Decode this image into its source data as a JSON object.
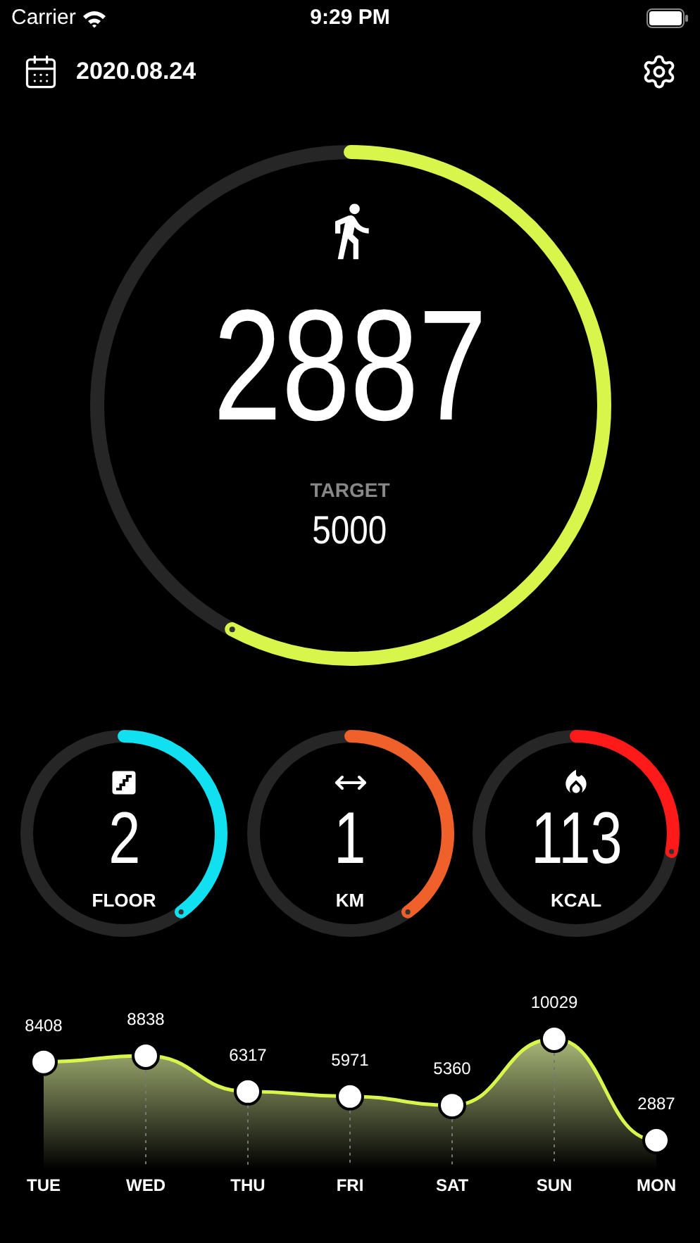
{
  "status_bar": {
    "carrier": "Carrier",
    "time": "9:29 PM"
  },
  "header": {
    "date": "2020.08.24"
  },
  "steps": {
    "value": "2887",
    "target_label": "TARGET",
    "target": "5000"
  },
  "metrics": [
    {
      "kind": "floor",
      "value": "2",
      "unit": "FLOOR",
      "color": "#10e0f0"
    },
    {
      "kind": "distance",
      "value": "1",
      "unit": "KM",
      "color": "#f0602a"
    },
    {
      "kind": "calories",
      "value": "113",
      "unit": "KCAL",
      "color": "#ff1a1a"
    }
  ],
  "weekly": {
    "chart_data": {
      "type": "area",
      "categories": [
        "TUE",
        "WED",
        "THU",
        "FRI",
        "SAT",
        "SUN",
        "MON"
      ],
      "series": [
        {
          "color": "#d8f54c",
          "values": [
            8408,
            8838,
            6317,
            5971,
            5360,
            10029,
            2887
          ]
        }
      ],
      "data_labels": true
    }
  }
}
